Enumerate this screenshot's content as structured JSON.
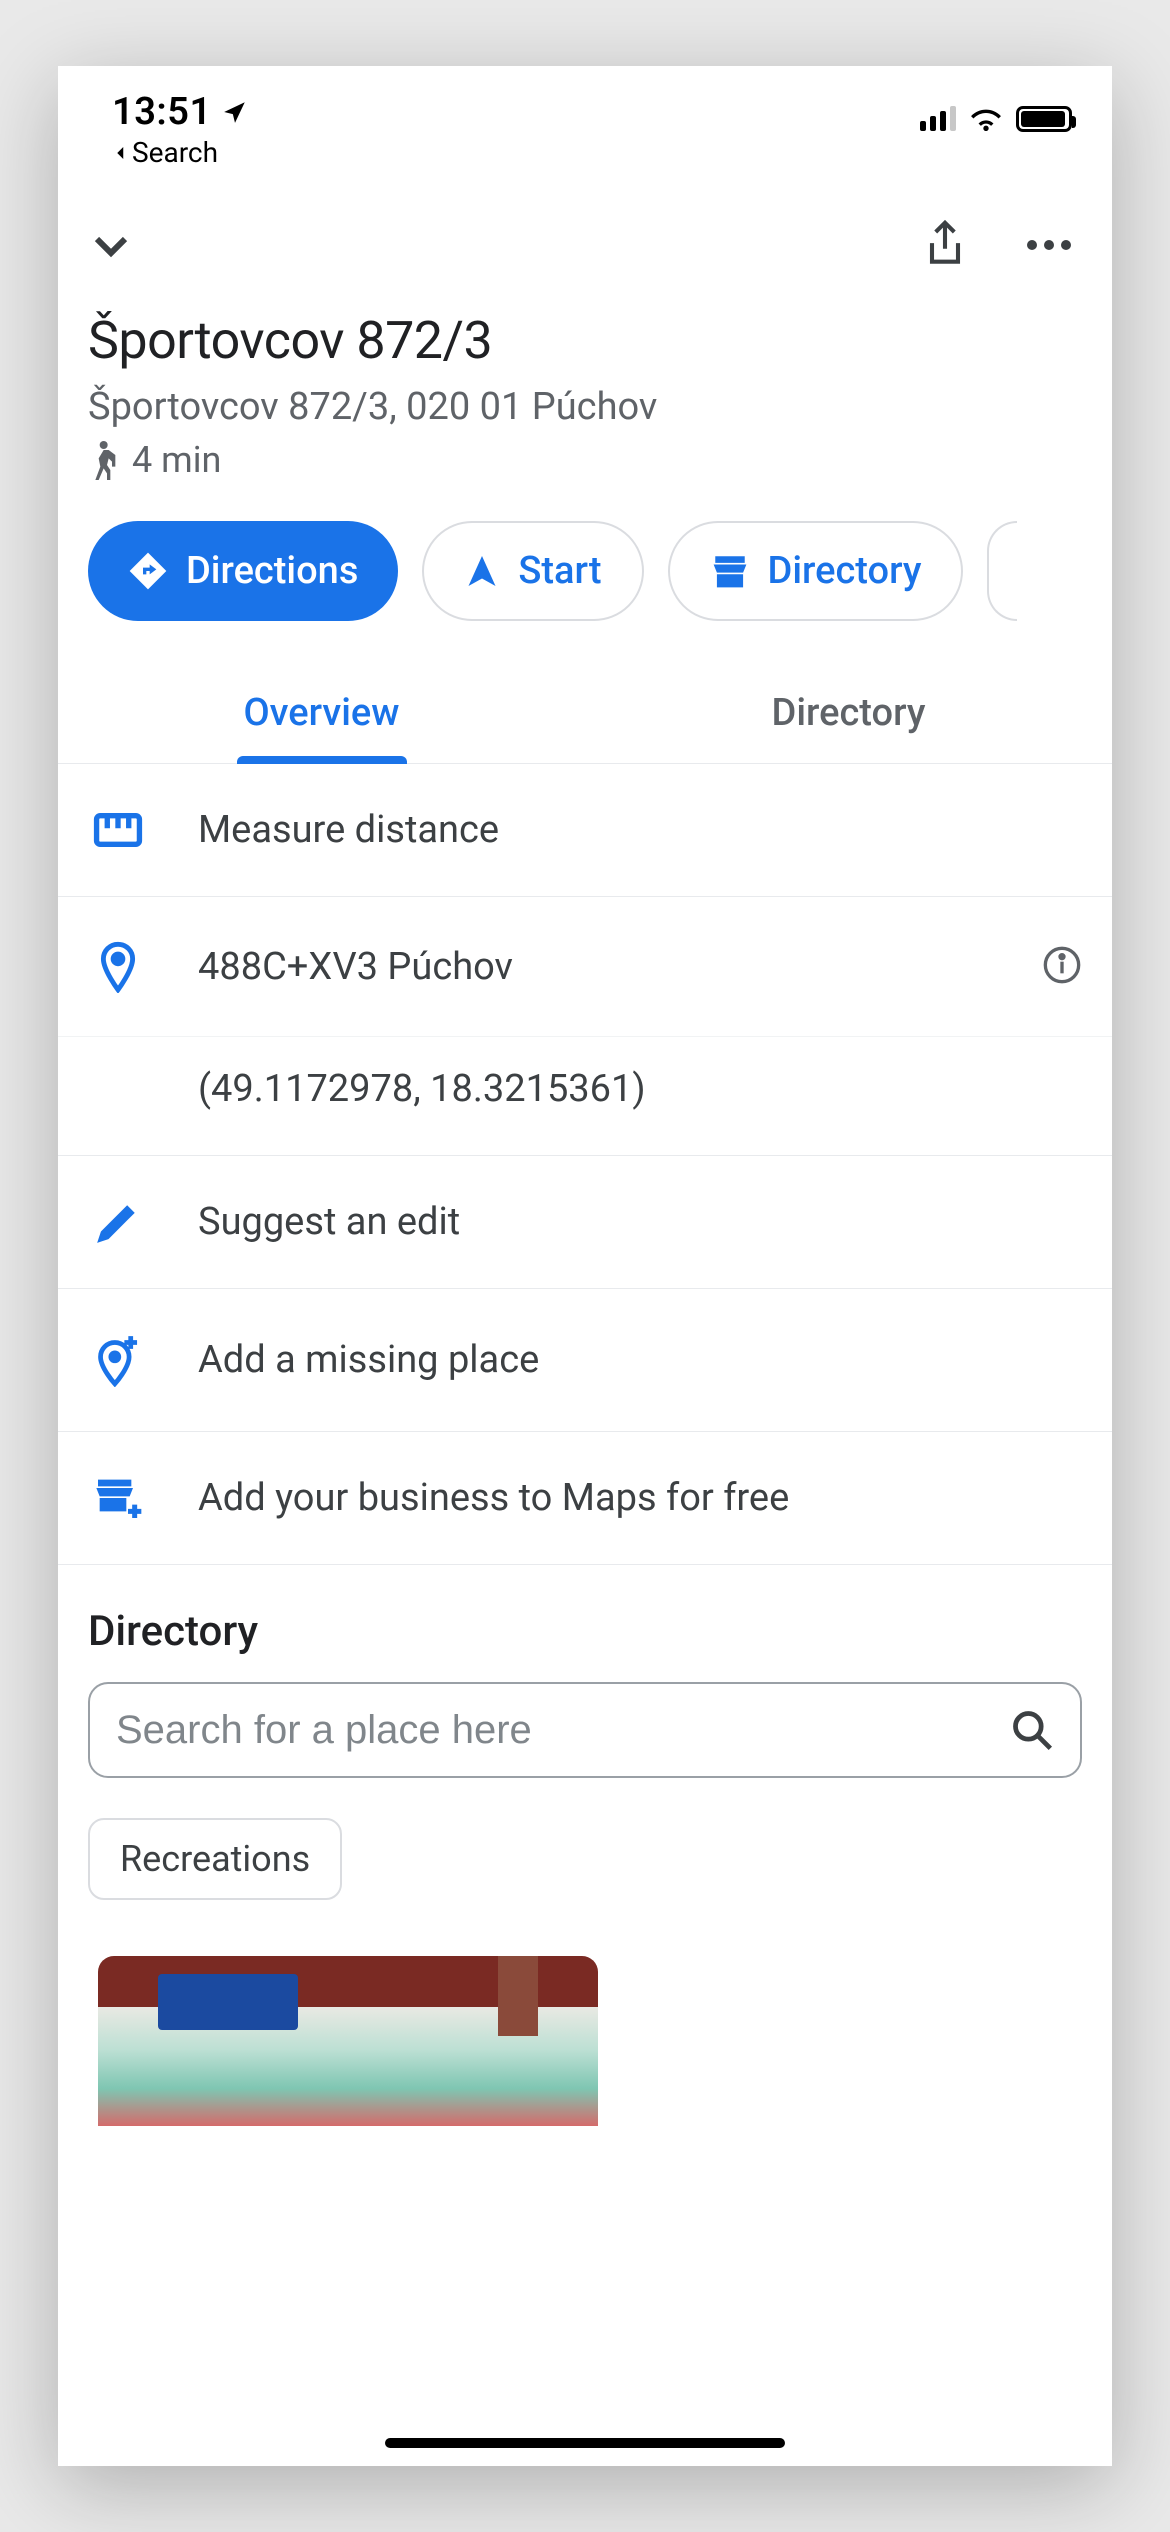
{
  "status": {
    "time": "13:51",
    "back_label": "Search"
  },
  "place": {
    "title": "Športovcov 872/3",
    "address": "Športovcov 872/3, 020 01 Púchov",
    "travel_time": "4 min"
  },
  "actions": {
    "directions": "Directions",
    "start": "Start",
    "directory": "Directory"
  },
  "tabs": {
    "overview": "Overview",
    "directory": "Directory"
  },
  "rows": {
    "measure": "Measure distance",
    "plus_code": "488C+XV3 Púchov",
    "coords": "(49.1172978, 18.3215361)",
    "suggest": "Suggest an edit",
    "add_place": "Add a missing place",
    "add_business": "Add your business to Maps for free"
  },
  "directory": {
    "title": "Directory",
    "search_placeholder": "Search for a place here",
    "chip": "Recreations"
  }
}
